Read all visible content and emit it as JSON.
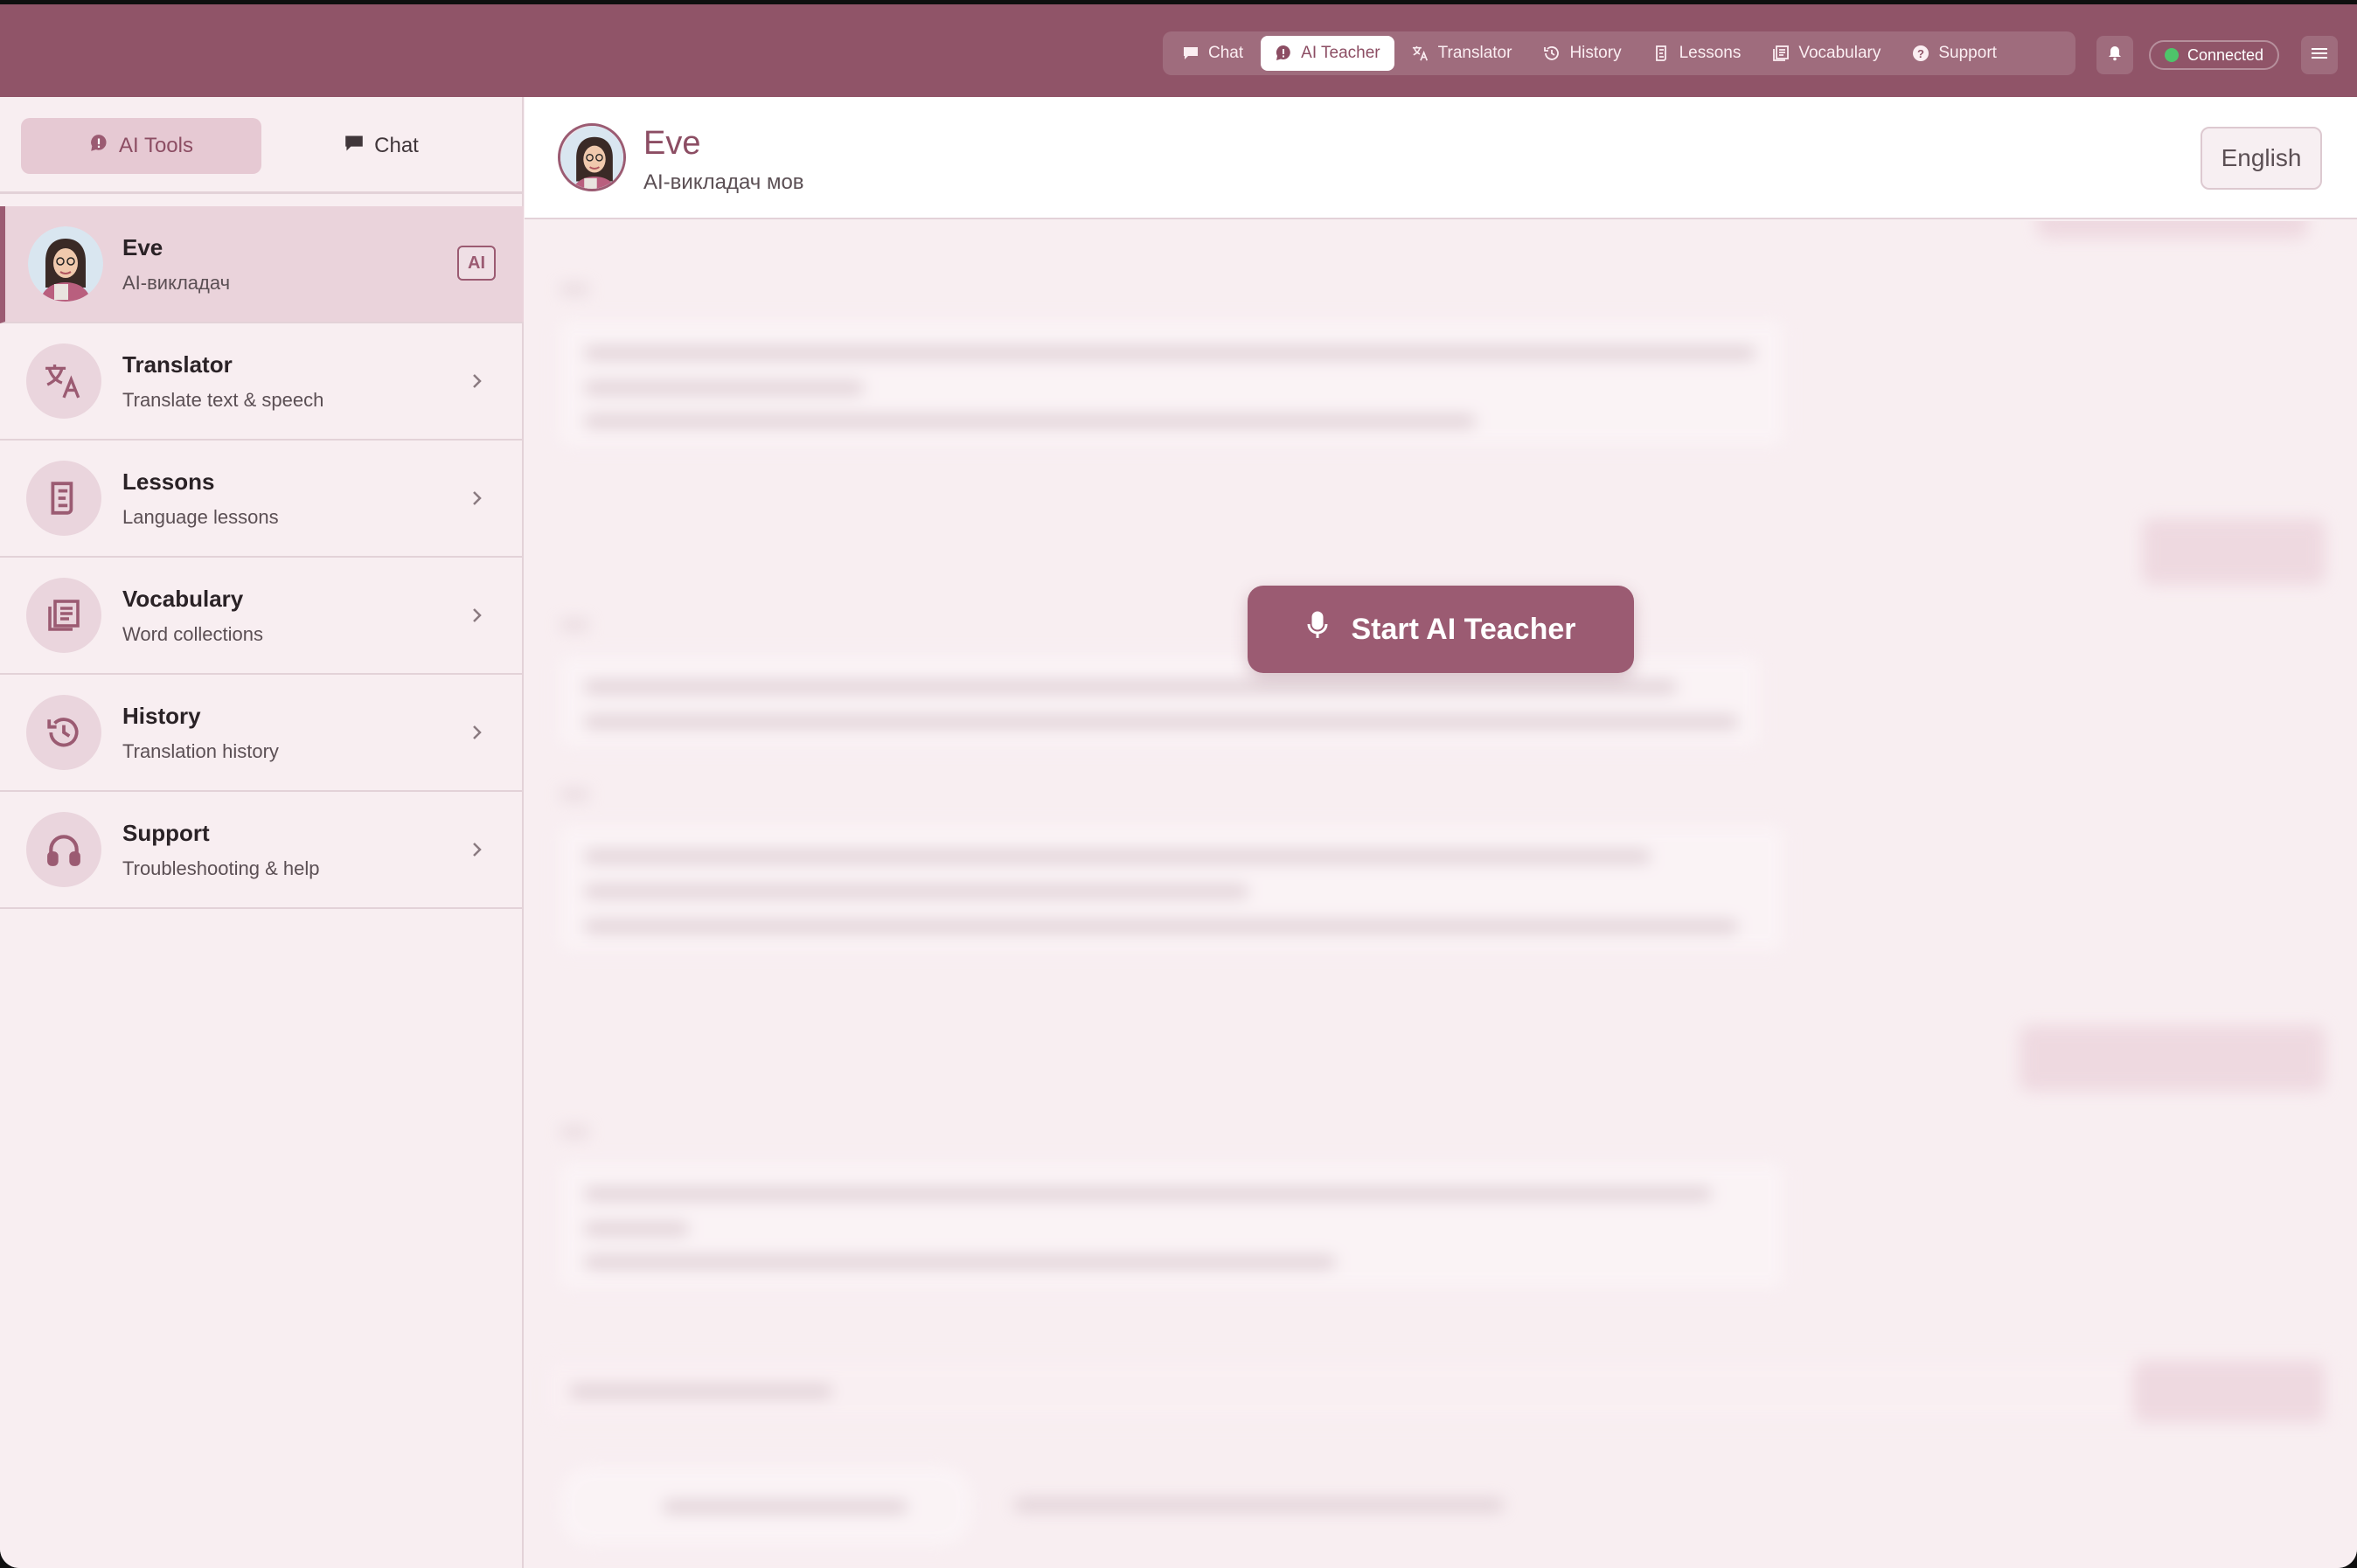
{
  "topnav": {
    "items": [
      {
        "label": "Chat",
        "icon": "chat-icon"
      },
      {
        "label": "AI Teacher",
        "icon": "ai-teacher-icon",
        "active": true
      },
      {
        "label": "Translator",
        "icon": "translate-icon"
      },
      {
        "label": "History",
        "icon": "history-icon"
      },
      {
        "label": "Lessons",
        "icon": "lessons-icon"
      },
      {
        "label": "Vocabulary",
        "icon": "vocabulary-icon"
      },
      {
        "label": "Support",
        "icon": "help-icon"
      }
    ],
    "status_label": "Connected"
  },
  "sidebar": {
    "tabs": [
      {
        "label": "AI Tools",
        "icon": "ai-tools-icon",
        "active": true
      },
      {
        "label": "Chat",
        "icon": "chat-icon"
      }
    ],
    "items": [
      {
        "title": "Eve",
        "subtitle": "AI-викладач",
        "badge": "AI",
        "active": true
      },
      {
        "title": "Translator",
        "subtitle": "Translate text & speech",
        "icon": "translate-icon"
      },
      {
        "title": "Lessons",
        "subtitle": "Language lessons",
        "icon": "lessons-icon"
      },
      {
        "title": "Vocabulary",
        "subtitle": "Word collections",
        "icon": "vocabulary-icon"
      },
      {
        "title": "History",
        "subtitle": "Translation history",
        "icon": "history-icon"
      },
      {
        "title": "Support",
        "subtitle": "Troubleshooting & help",
        "icon": "headphones-icon"
      }
    ]
  },
  "main": {
    "name": "Eve",
    "subtitle": "AI-викладач мов",
    "language_button": "English",
    "start_button": "Start AI Teacher"
  },
  "colors": {
    "brand": "#905468",
    "accent": "#9b5b72",
    "status_online": "#4ec46a",
    "background": "#f8eef1"
  }
}
